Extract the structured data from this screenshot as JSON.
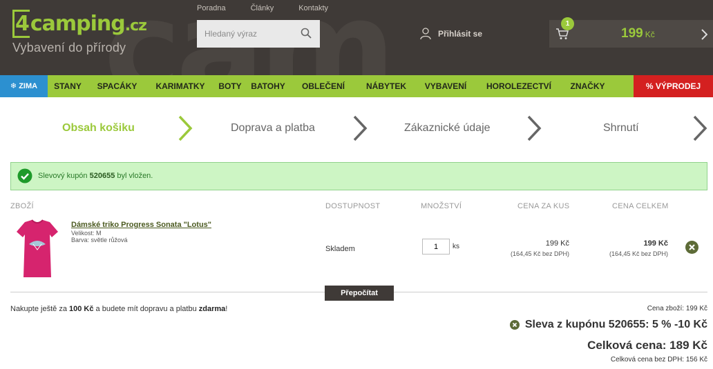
{
  "header": {
    "bg_text": "cam",
    "logo": {
      "four": "4",
      "main": "camping",
      "tld": ".cz",
      "tagline": "Vybavení do přírody"
    },
    "toplinks": [
      "Poradna",
      "Články",
      "Kontakty"
    ],
    "search": {
      "placeholder": "Hledaný výraz"
    },
    "login_label": "Přihlásit se",
    "cart": {
      "count": "1",
      "total": "199",
      "currency": "Kč"
    }
  },
  "nav": {
    "zima": "❄ ZIMA",
    "items": [
      "STANY",
      "SPACÁKY",
      "KARIMATKY",
      "BOTY",
      "BATOHY",
      "OBLEČENÍ",
      "NÁBYTEK",
      "VYBAVENÍ",
      "HOROLEZECTVÍ",
      "ZNAČKY"
    ],
    "sale": "% VÝPRODEJ"
  },
  "steps": [
    "Obsah košiku",
    "Doprava a platba",
    "Zákaznické údaje",
    "Shrnutí"
  ],
  "alert": {
    "prefix": "Slevový kupón ",
    "code": "520655",
    "suffix": " byl vložen."
  },
  "table": {
    "headers": {
      "goods": "ZBOŽÍ",
      "availability": "DOSTUPNOST",
      "quantity": "MNOŽSTVÍ",
      "unit_price": "CENA ZA KUS",
      "total_price": "CENA CELKEM"
    }
  },
  "item": {
    "name": "Dámské triko Progress Sonata \"Lotus\"",
    "size": "Velikost: M",
    "color": "Barva: světle růžová",
    "availability": "Skladem",
    "qty": "1",
    "unit": "ks",
    "unit_price": "199 Kč",
    "unit_price_novat": "(164,45 Kč bez DPH)",
    "total_price": "199 Kč",
    "total_price_novat": "(164,45 Kč bez DPH)"
  },
  "recalc_label": "Přepočítat",
  "free_shipping": {
    "p1": "Nakupte ještě za ",
    "amount": "100 Kč",
    "p2": " a budete mít dopravu a platbu ",
    "free": "zdarma",
    "p3": "!"
  },
  "summary": {
    "goods_price": "Cena zboží: 199 Kč",
    "coupon": "Sleva z kupónu 520655: 5 % -10 Kč",
    "total": "Celková cena: 189 Kč",
    "total_novat": "Celková cena bez DPH: 156 Kč"
  },
  "colors": {
    "brand_green": "#9bc93b",
    "header_dark": "#3f3a37",
    "zima_blue": "#2c90d0",
    "sale_red": "#d42020"
  }
}
